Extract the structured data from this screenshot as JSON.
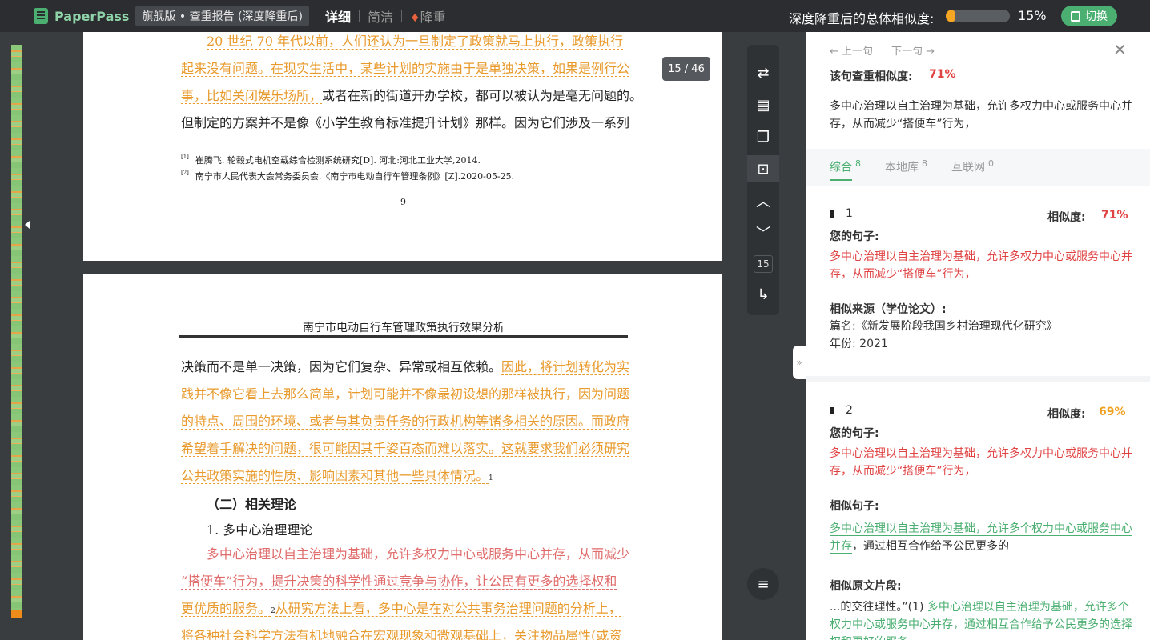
{
  "topbar": {
    "logo": "PaperPass",
    "edition": "旗舰版 • 查重报告 (深度降重后)",
    "modes": [
      "详细",
      "简洁",
      "降重"
    ],
    "similarity_label": "深度降重后的总体相似度:",
    "similarity_value": 0.15,
    "similarity_pct": "15%",
    "switch_label": "切换"
  },
  "page_indicator": "15 / 46",
  "toolbar": {
    "page_num": "15"
  },
  "page1": {
    "lines": [
      {
        "hl": "20 世纪 70 年代以前，人们还认为一旦制定了政策就马上执行，政策执行",
        "plain": ""
      },
      {
        "hl": "起来没有问题。在现实生活中，某些计划的实施由于是单独决策，如果是例行公",
        "plain": ""
      },
      {
        "hl": "事，比如关闭娱乐场所，",
        "plain": "或者在新的街道开办学校，都可以被认为是毫无问题的。"
      },
      {
        "hl": "",
        "plain": "但制定的方案并不是像《小学生教育标准提升计划》那样。因为它们涉及一系列"
      }
    ],
    "footnote1_mark": "[1]",
    "footnote1": "崔腾飞. 轮毂式电机空载综合检测系统研究[D]. 河北:河北工业大学,2014.",
    "footnote2_mark": "[2]",
    "footnote2": "南宁市人民代表大会常务委员会.《南宁市电动自行车管理条例》[Z].2020-05-25.",
    "page_number": "9"
  },
  "page2": {
    "header": "南宁市电动自行车管理政策执行效果分析",
    "line1_plain": "决策而不是单一决策，因为它们复杂、异常或相互依赖。",
    "line1_hl": "因此，将计划转化为实",
    "lines_hl": [
      "践并不像它看上去那么简单，计划可能并不像最初设想的那样被执行，因为问题",
      "的特点、周围的环境、或者与其负责任务的行政机构等诸多相关的原因。而政府",
      "希望着手解决的问题，很可能因其千姿百态而难以落实。这就要求我们必须研究"
    ],
    "line5_hl": "公共政策实施的性质、影响因素和其他一些具体情况。",
    "line5_sup": "1",
    "heading": "（二）相关理论",
    "subheading": "1. 多中心治理理论",
    "red1": "多中心治理以自主治理为基础，允许多权力中心或服务中心并存，从而减少",
    "red2": "“搭便车”行为，提升决策的科学性通过竞争与协作，让公民有更多的选择权和",
    "line_o1": "更优质的服务。",
    "line_o1_sup": "2",
    "line_o1_rest": "从研究方法上看，多中心是在对公共事务治理问题的分析上，",
    "line_o2": "将各种社会科学方法有机地融合在宏观现象和微观基础上，关注物品属性(或资"
  },
  "panel": {
    "prev": "上一句",
    "next": "下一句",
    "sentence_label": "该句查重相似度:",
    "sentence_value": "71%",
    "sentence_text": "多中心治理以自主治理为基础，允许多权力中心或服务中心并存，从而减少“搭便车”行为，",
    "tabs": [
      {
        "label": "综合",
        "count": "8"
      },
      {
        "label": "本地库",
        "count": "8"
      },
      {
        "label": "互联网",
        "count": "0"
      }
    ],
    "results": [
      {
        "num": "1",
        "sim_label": "相似度:",
        "sim": "71%",
        "sim_color": "#e04343",
        "your_label": "您的句子:",
        "your_text": "多中心治理以自主治理为基础，允许多权力中心或服务中心并存，从而减少“搭便车”行为，",
        "source_label": "相似来源（学位论文）:",
        "title": "篇名:《新发展阶段我国乡村治理现代化研究》",
        "year": "年份: 2021"
      },
      {
        "num": "2",
        "sim_label": "相似度:",
        "sim": "69%",
        "sim_color": "#f0a020",
        "your_label": "您的句子:",
        "your_text": "多中心治理以自主治理为基础，允许多权力中心或服务中心并存，从而减少“搭便车”行为，",
        "similar_label": "相似句子:",
        "similar_green": "多中心治理以自主治理为基础，允许多个权力中心或服务中心并存",
        "similar_rest": "，通过相互合作给予公民更多的",
        "original_label": "相似原文片段:",
        "original_prefix": "...的交往理性。”(1) ",
        "original_green": "多中心治理以自主治理为基础，允许多个权力中心或服务中心并存，通过相互合作给予公民更多的选择权和更好的服务"
      }
    ]
  }
}
